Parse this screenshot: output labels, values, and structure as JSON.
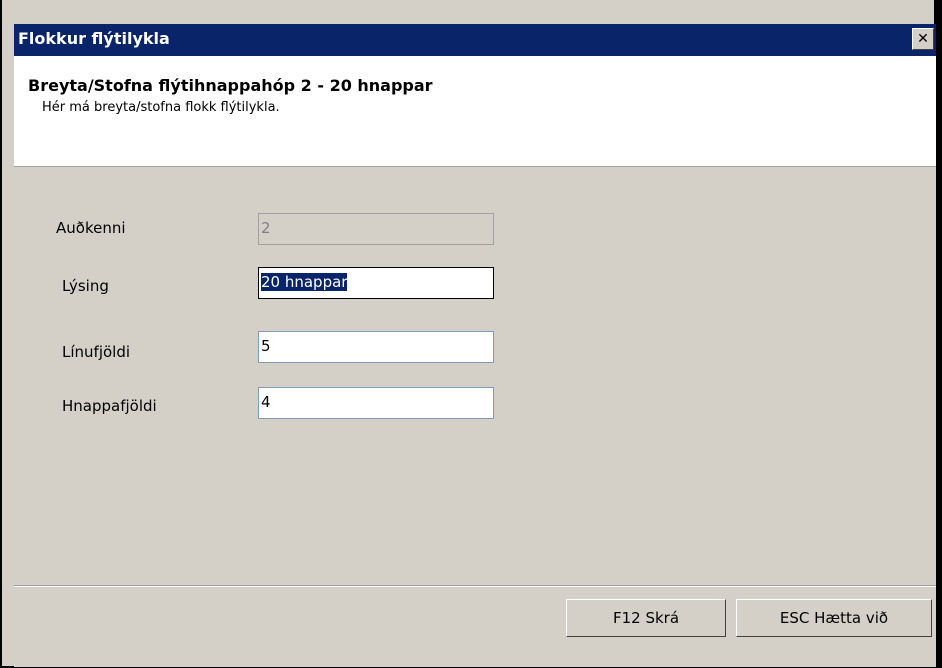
{
  "window": {
    "title": "Flokkur flýtilykla",
    "close_glyph": "✕"
  },
  "header": {
    "title": "Breyta/Stofna flýtihnappahóp 2 - 20 hnappar",
    "subtitle": "Hér má breyta/stofna flokk flýtilykla."
  },
  "form": {
    "id_label": "Auðkenni",
    "id_value": "2",
    "desc_label": "Lýsing",
    "desc_value": "20 hnappar",
    "rows_label": "Línufjöldi",
    "rows_value": "5",
    "buttons_label": "Hnappafjöldi",
    "buttons_value": "4"
  },
  "footer": {
    "save_label": "F12 Skrá",
    "cancel_label": "ESC Hætta við"
  }
}
